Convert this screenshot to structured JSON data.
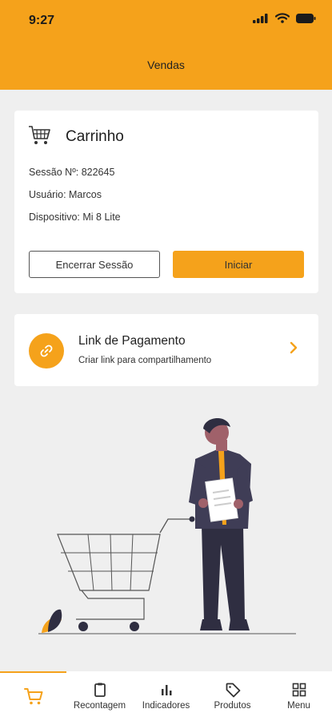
{
  "status_bar": {
    "time": "9:27"
  },
  "header": {
    "title": "Vendas"
  },
  "cart": {
    "title": "Carrinho",
    "session_label": "Sessão Nº: 822645",
    "user_label": "Usuário: Marcos",
    "device_label": "Dispositivo: Mi 8 Lite",
    "end_button": "Encerrar Sessão",
    "start_button": "Iniciar"
  },
  "payment_link": {
    "title": "Link de Pagamento",
    "subtitle": "Criar link para compartilhamento"
  },
  "bottom_nav": {
    "items": [
      {
        "label": "",
        "icon": "cart-icon",
        "active": true
      },
      {
        "label": "Recontagem",
        "icon": "clipboard-icon"
      },
      {
        "label": "Indicadores",
        "icon": "bar-chart-icon"
      },
      {
        "label": "Produtos",
        "icon": "tag-icon"
      },
      {
        "label": "Menu",
        "icon": "grid-icon"
      }
    ]
  },
  "colors": {
    "accent": "#f5a21b",
    "background": "#efefef",
    "card": "#ffffff"
  }
}
